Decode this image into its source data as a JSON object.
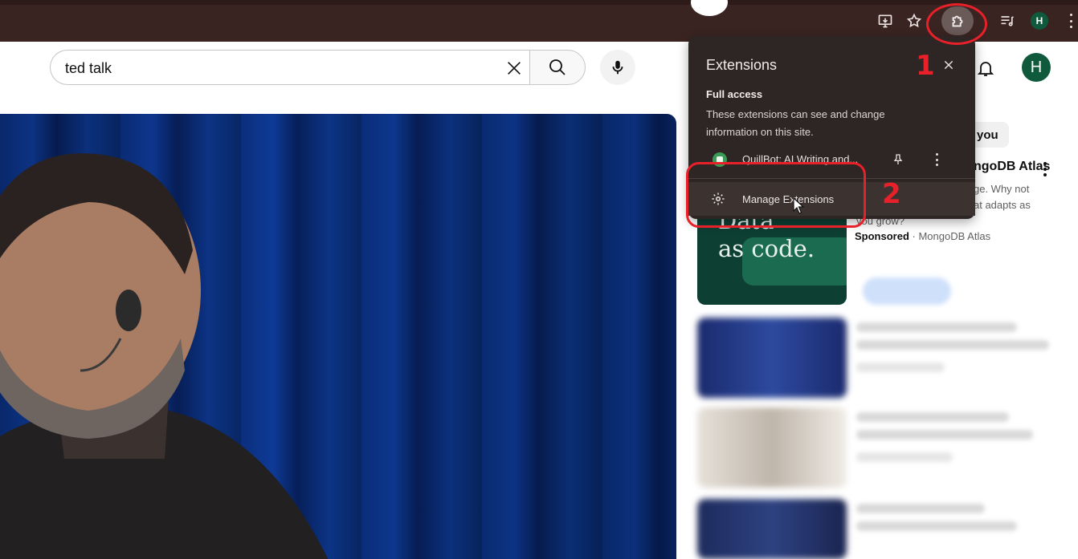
{
  "browser": {
    "toolbar_icons": [
      "install-app-icon",
      "bookmark-star-icon",
      "extensions-puzzle-icon",
      "media-playlist-icon",
      "profile-avatar",
      "browser-menu-icon"
    ],
    "profile_initial": "H",
    "background_color": "#3a2421"
  },
  "youtube_header": {
    "search_value": "ted talk",
    "avatar_initial": "H"
  },
  "extensions_popup": {
    "title": "Extensions",
    "section_title": "Full access",
    "section_description": "These extensions can see and change information on this site.",
    "extension_name": "QuillBot: AI Writing and...",
    "manage_label": "Manage Extensions",
    "background_color": "#2d2624"
  },
  "sidebar": {
    "chip_label": "r you",
    "ad": {
      "thumb_line1": "Data",
      "thumb_line2": "as code.",
      "title": "ngoDB Atlas",
      "desc_line1": "ge. Why not",
      "desc_line2": "at adapts as",
      "desc_line3": "you grow?",
      "sponsored_label": "Sponsored",
      "separator": " · ",
      "sponsor_name": "MongoDB Atlas"
    }
  },
  "annotations": {
    "step1": "1",
    "step2": "2",
    "color": "#e8202a"
  }
}
